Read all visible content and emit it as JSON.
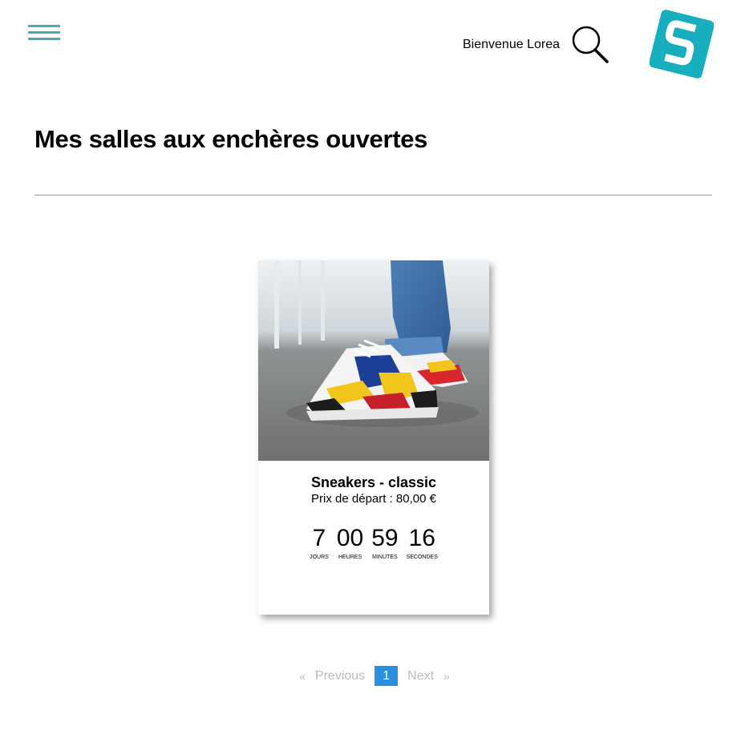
{
  "header": {
    "menu_icon": "hamburger-menu-icon",
    "welcome_text": "Bienvenue Lorea",
    "search_icon": "search-icon",
    "logo_icon": "site-logo",
    "accent_color": "#4fa8b8",
    "logo_color": "#17aebe"
  },
  "main": {
    "title": "Mes salles aux enchères ouvertes"
  },
  "auctions": [
    {
      "image": "sneaker-photo",
      "title": "Sneakers - classic",
      "price": "Prix de départ : 80,00 €",
      "countdown": {
        "days": "7",
        "days_label": "JOURS",
        "hours": "00",
        "hours_label": "HEURES",
        "minutes": "59",
        "minutes_label": "MINUTES",
        "seconds": "16",
        "seconds_label": "SECONDES"
      }
    }
  ],
  "pagination": {
    "prev_arrow": "«",
    "previous_label": "Previous",
    "current_page": "1",
    "next_label": "Next",
    "next_arrow": "»",
    "active_color": "#2b8fe0"
  }
}
